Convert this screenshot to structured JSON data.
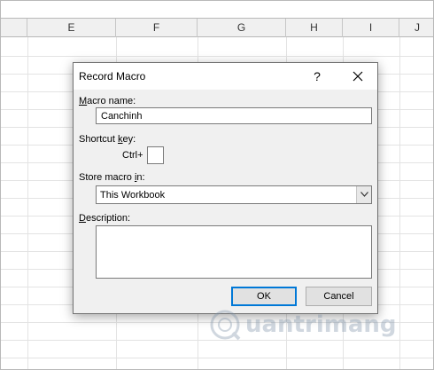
{
  "sheet": {
    "columns": [
      "E",
      "F",
      "G",
      "H",
      "I",
      "J"
    ]
  },
  "dialog": {
    "title": "Record Macro",
    "help_label": "?",
    "close_icon": "close-icon",
    "macro_name_label_first": "M",
    "macro_name_label_rest": "acro name:",
    "macro_name_value": "Canchinh",
    "shortcut_label_first": "Shortcut ",
    "shortcut_label_u": "k",
    "shortcut_label_rest": "ey:",
    "shortcut_prefix": "Ctrl+",
    "shortcut_value": "",
    "store_label_first": "Store macro ",
    "store_label_u": "i",
    "store_label_rest": "n:",
    "store_value": "This Workbook",
    "description_label_first": "D",
    "description_label_rest": "escription:",
    "description_value": "",
    "ok_label": "OK",
    "cancel_label": "Cancel"
  },
  "watermark": {
    "text": "uantrimang"
  },
  "colors": {
    "dialog_bg": "#f0f0f0",
    "default_button_border": "#0078d7",
    "grid_line": "#e3e3e3"
  }
}
